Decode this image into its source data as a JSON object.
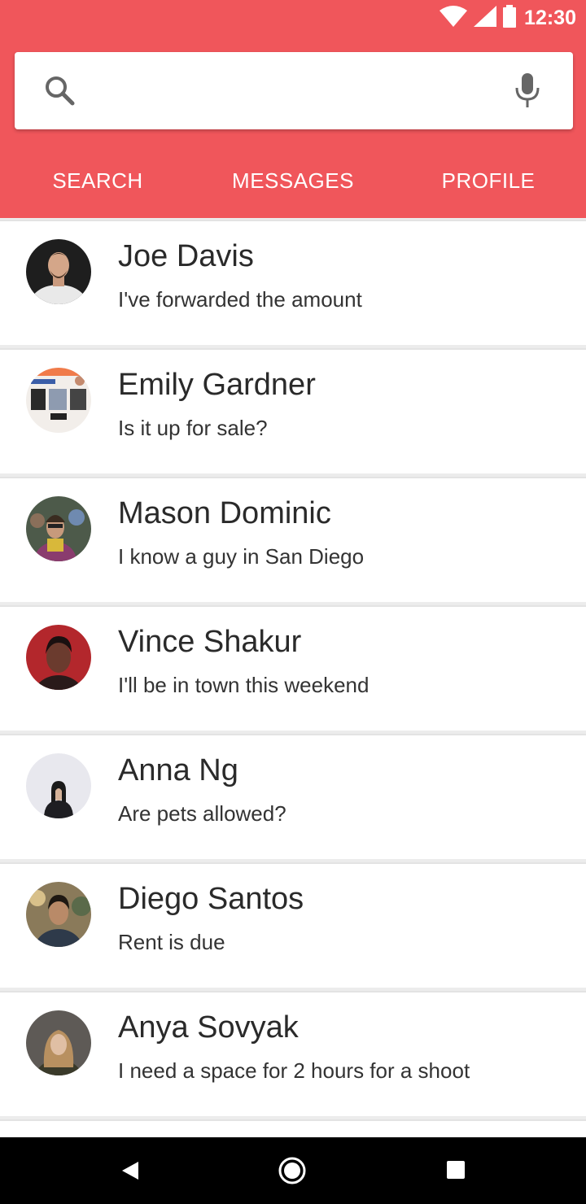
{
  "status_bar": {
    "time": "12:30",
    "icons": [
      "wifi-icon",
      "cellular-signal-icon",
      "battery-icon"
    ]
  },
  "search": {
    "value": "",
    "placeholder": "",
    "icon": "search-icon",
    "voice_icon": "mic-icon"
  },
  "tabs": [
    {
      "label": "SEARCH"
    },
    {
      "label": "MESSAGES"
    },
    {
      "label": "PROFILE"
    }
  ],
  "conversations": [
    {
      "name": "Joe Davis",
      "message": "I've forwarded the amount"
    },
    {
      "name": "Emily Gardner",
      "message": "Is it up for sale?"
    },
    {
      "name": "Mason Dominic",
      "message": "I know a guy in San Diego"
    },
    {
      "name": "Vince Shakur",
      "message": "I'll be in town this weekend"
    },
    {
      "name": "Anna Ng",
      "message": "Are pets allowed?"
    },
    {
      "name": "Diego Santos",
      "message": "Rent is due"
    },
    {
      "name": "Anya Sovyak",
      "message": "I need a space for 2 hours for a shoot"
    }
  ],
  "nav_bar": {
    "icons": [
      "back-icon",
      "home-icon",
      "recents-icon"
    ]
  },
  "colors": {
    "accent": "#f0565b",
    "divider": "#e3e3e3",
    "text": "#2a2a2a"
  }
}
